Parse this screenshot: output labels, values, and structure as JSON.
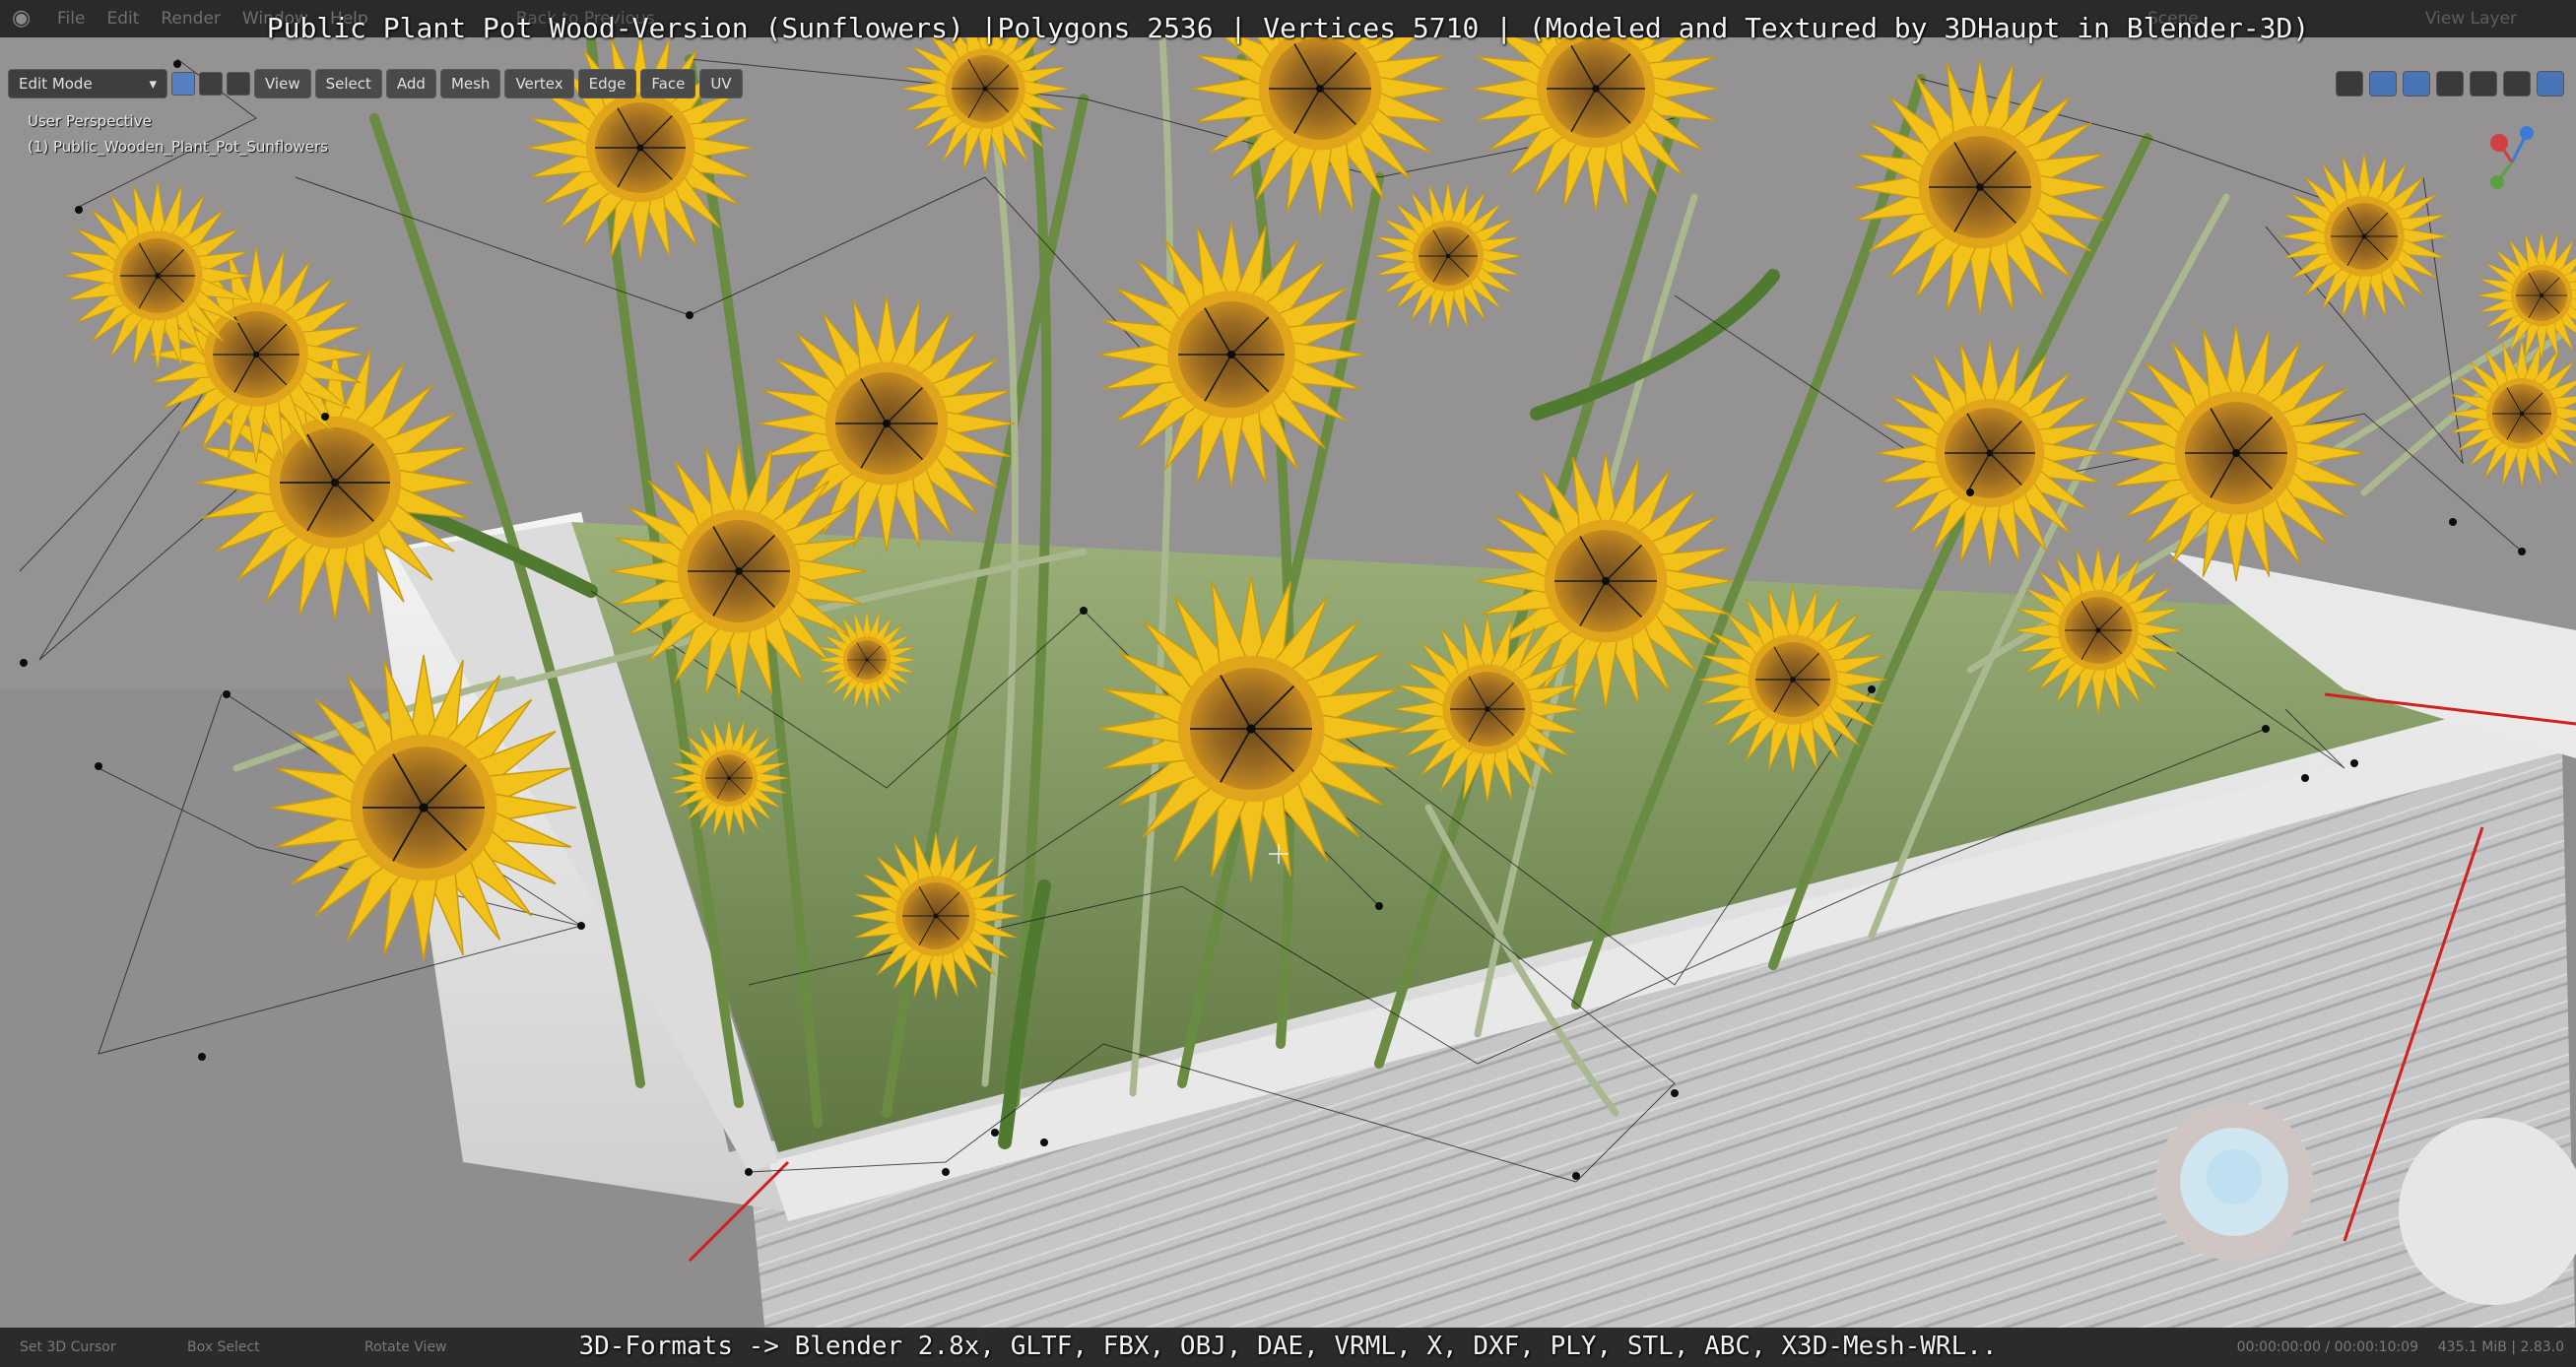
{
  "menubar": {
    "items": [
      "File",
      "Edit",
      "Render",
      "Window",
      "Help"
    ],
    "back_label": "Back to Previous",
    "scene_label": "Scene",
    "view_layer_label": "View Layer"
  },
  "banner": {
    "title": "Public Plant Pot Wood-Version (Sunflowers) |Polygons 2536 | Vertices 5710 | (Modeled and Textured by 3DHaupt in Blender-3D)",
    "formats": "3D-Formats -> Blender 2.8x, GLTF, FBX, OBJ, DAE, VRML, X, DXF, PLY, STL, ABC, X3D-Mesh-WRL.."
  },
  "header": {
    "mode": "Edit Mode",
    "menus": [
      "View",
      "Select",
      "Add",
      "Mesh",
      "Vertex",
      "Edge",
      "Face",
      "UV"
    ]
  },
  "viewport": {
    "perspective": "User Perspective",
    "object_name": "(1) Public_Wooden_Plant_Pot_Sunflowers"
  },
  "statusbar": {
    "select": "Set 3D Cursor",
    "box_select": "Box Select",
    "rotate": "Rotate View",
    "stats": "435.1 MiB | 2.83.0",
    "timer": "00:00:00:00 / 00:00:10:09"
  },
  "colors": {
    "background": "#8f8d8d",
    "pot": "#d9d9d9",
    "petal": "#f2c21a",
    "center": "#8a5a1e",
    "stem": "#5f8a3c",
    "edge_selected": "#d02020"
  }
}
